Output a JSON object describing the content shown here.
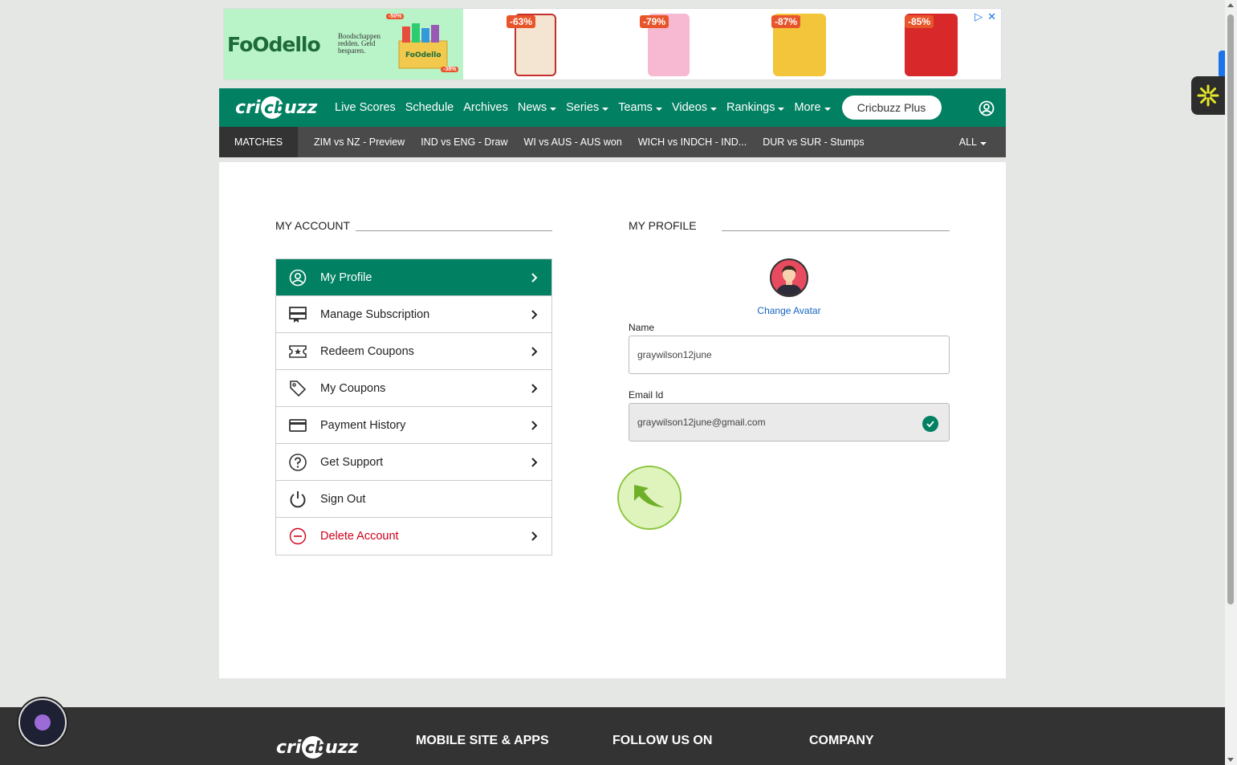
{
  "ad": {
    "brand": "FoOdello",
    "tagline": "Boodschappen redden. Geld besparen.",
    "badge_top": "-50%",
    "badge_bottom": "-38%",
    "products": [
      {
        "discount": "-63%",
        "color": "#c4302b"
      },
      {
        "discount": "-79%",
        "color": "#e86fa0"
      },
      {
        "discount": "-87%",
        "color": "#e8b82a"
      },
      {
        "discount": "-85%",
        "color": "#d8282a"
      }
    ]
  },
  "header": {
    "logo": "cricbuzz",
    "nav": [
      {
        "label": "Live Scores",
        "dropdown": false
      },
      {
        "label": "Schedule",
        "dropdown": false
      },
      {
        "label": "Archives",
        "dropdown": false
      },
      {
        "label": "News",
        "dropdown": true
      },
      {
        "label": "Series",
        "dropdown": true
      },
      {
        "label": "Teams",
        "dropdown": true
      },
      {
        "label": "Videos",
        "dropdown": true
      },
      {
        "label": "Rankings",
        "dropdown": true
      },
      {
        "label": "More",
        "dropdown": true
      }
    ],
    "plus_label": "Cricbuzz Plus"
  },
  "subnav": {
    "matches_label": "MATCHES",
    "matches": [
      "ZIM vs NZ - Preview",
      "IND vs ENG - Draw",
      "WI vs AUS - AUS won",
      "WICH vs INDCH - IND...",
      "DUR vs SUR - Stumps"
    ],
    "all_label": "ALL"
  },
  "account": {
    "title": "MY ACCOUNT",
    "items": [
      {
        "label": "My Profile",
        "icon": "user-circle-icon",
        "chevron": true,
        "state": "active"
      },
      {
        "label": "Manage Subscription",
        "icon": "subscription-icon",
        "chevron": true,
        "state": ""
      },
      {
        "label": "Redeem Coupons",
        "icon": "ticket-icon",
        "chevron": true,
        "state": ""
      },
      {
        "label": "My Coupons",
        "icon": "tag-icon",
        "chevron": true,
        "state": ""
      },
      {
        "label": "Payment History",
        "icon": "card-icon",
        "chevron": true,
        "state": ""
      },
      {
        "label": "Get Support",
        "icon": "help-icon",
        "chevron": true,
        "state": ""
      },
      {
        "label": "Sign Out",
        "icon": "power-icon",
        "chevron": false,
        "state": ""
      },
      {
        "label": "Delete Account",
        "icon": "minus-circle-icon",
        "chevron": true,
        "state": "danger"
      }
    ]
  },
  "profile": {
    "title": "MY PROFILE",
    "change_avatar": "Change Avatar",
    "name_label": "Name",
    "name_value": "graywilson12june",
    "email_label": "Email Id",
    "email_value": "graywilson12june@gmail.com"
  },
  "footer": {
    "logo": "cricbuzz",
    "headings": [
      "MOBILE SITE & APPS",
      "FOLLOW US ON",
      "COMPANY"
    ]
  },
  "colors": {
    "brand_green": "#028062",
    "danger": "#d0021b",
    "link": "#1565c0"
  }
}
